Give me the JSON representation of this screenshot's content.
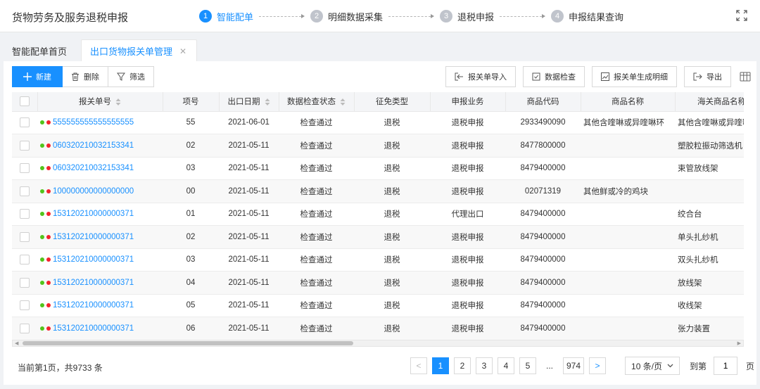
{
  "app": {
    "title": "货物劳务及服务退税申报"
  },
  "steps": [
    {
      "num": "1",
      "label": "智能配单",
      "active": true
    },
    {
      "num": "2",
      "label": "明细数据采集",
      "active": false
    },
    {
      "num": "3",
      "label": "退税申报",
      "active": false
    },
    {
      "num": "4",
      "label": "申报结果查询",
      "active": false
    }
  ],
  "tabs": {
    "home": "智能配单首页",
    "active": "出口货物报关单管理",
    "close": "✕"
  },
  "toolbar": {
    "new": "新建",
    "delete": "删除",
    "filter": "筛选",
    "import": "报关单导入",
    "check": "数据检查",
    "generate": "报关单生成明细",
    "export": "导出"
  },
  "columns": [
    "报关单号",
    "项号",
    "出口日期",
    "数据检查状态",
    "征免类型",
    "申报业务",
    "商品代码",
    "商品名称",
    "海关商品名称"
  ],
  "rows": [
    [
      "555555555555555555",
      "55",
      "2021-06-01",
      "检查通过",
      "退税",
      "退税申报",
      "2933490090",
      "其他含喹啉或异喹啉环",
      "其他含喹啉或异喹啉环"
    ],
    [
      "060320210032153341",
      "02",
      "2021-05-11",
      "检查通过",
      "退税",
      "退税申报",
      "8477800000",
      "",
      "塑胶粒振动筛选机"
    ],
    [
      "060320210032153341",
      "03",
      "2021-05-11",
      "检查通过",
      "退税",
      "退税申报",
      "8479400000",
      "",
      "束管放线架"
    ],
    [
      "100000000000000000",
      "00",
      "2021-05-11",
      "检查通过",
      "退税",
      "退税申报",
      "02071319",
      "其他鲜或冷的鸡块",
      ""
    ],
    [
      "153120210000000371",
      "01",
      "2021-05-11",
      "检查通过",
      "退税",
      "代理出口",
      "8479400000",
      "",
      "绞合台"
    ],
    [
      "153120210000000371",
      "02",
      "2021-05-11",
      "检查通过",
      "退税",
      "退税申报",
      "8479400000",
      "",
      "单头扎纱机"
    ],
    [
      "153120210000000371",
      "03",
      "2021-05-11",
      "检查通过",
      "退税",
      "退税申报",
      "8479400000",
      "",
      "双头扎纱机"
    ],
    [
      "153120210000000371",
      "04",
      "2021-05-11",
      "检查通过",
      "退税",
      "退税申报",
      "8479400000",
      "",
      "放线架"
    ],
    [
      "153120210000000371",
      "05",
      "2021-05-11",
      "检查通过",
      "退税",
      "退税申报",
      "8479400000",
      "",
      "收线架"
    ],
    [
      "153120210000000371",
      "06",
      "2021-05-11",
      "检查通过",
      "退税",
      "退税申报",
      "8479400000",
      "",
      "张力装置"
    ]
  ],
  "status_colors": {
    "green": "#52c41a",
    "red": "#f5222d",
    "accent": "#1890ff"
  },
  "footer": {
    "info": "当前第1页，共9733 条",
    "pages": [
      "1",
      "2",
      "3",
      "4",
      "5",
      "...",
      "974"
    ],
    "prev": "<",
    "next": ">",
    "page_size": "10 条/页",
    "goto_label": "到第",
    "goto_value": "1",
    "goto_suffix": "页"
  },
  "icons": {
    "expand": "expand-icon",
    "settings": "column-settings-icon"
  }
}
